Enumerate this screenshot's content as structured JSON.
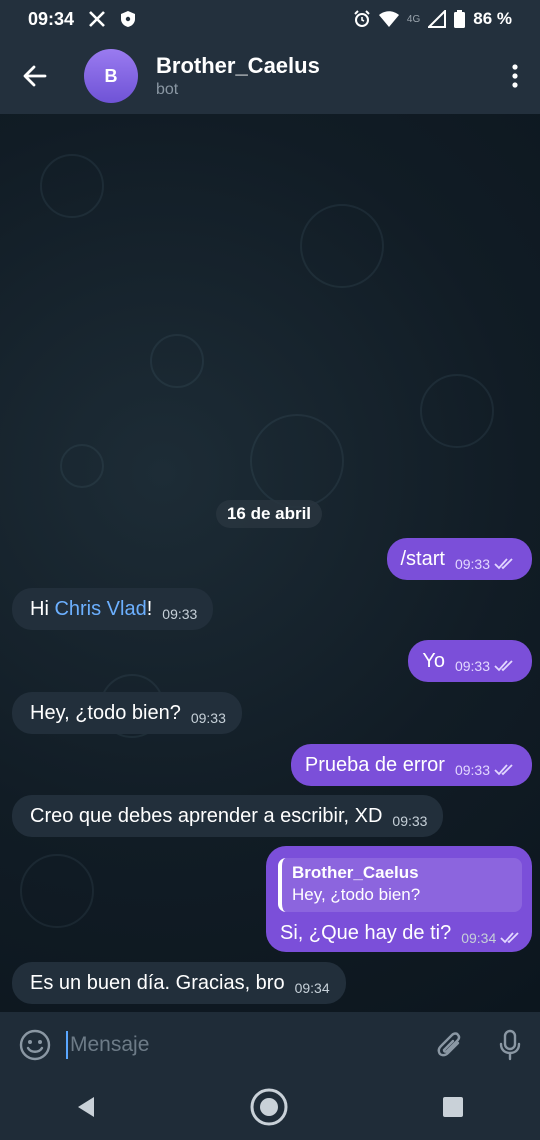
{
  "status": {
    "time": "09:34",
    "network": "4G",
    "battery": "86 %"
  },
  "header": {
    "avatar_letter": "B",
    "title": "Brother_Caelus",
    "subtitle": "bot"
  },
  "date_separator": "16 de abril",
  "messages": [
    {
      "text": "/start",
      "time": "09:33"
    },
    {
      "prefix": "Hi ",
      "mention": "Chris Vlad",
      "suffix": "!",
      "time": "09:33"
    },
    {
      "text": "Yo",
      "time": "09:33"
    },
    {
      "text": "Hey, ¿todo bien?",
      "time": "09:33"
    },
    {
      "text": "Prueba de error",
      "time": "09:33"
    },
    {
      "text": "Creo que debes aprender a escribir, XD",
      "time": "09:33"
    },
    {
      "reply_name": "Brother_Caelus",
      "reply_text": "Hey, ¿todo bien?",
      "text": "Si, ¿Que hay de ti?",
      "time": "09:34"
    },
    {
      "text": "Es un buen día. Gracias, bro",
      "time": "09:34"
    }
  ],
  "composer": {
    "placeholder": "Mensaje"
  },
  "icons": [
    "x-logo-icon",
    "shield-icon",
    "alarm-icon",
    "wifi-icon",
    "signal-icon",
    "battery-icon",
    "back-arrow-icon",
    "more-vert-icon",
    "emoji-icon",
    "attach-icon",
    "mic-icon",
    "nav-back-icon",
    "nav-home-icon",
    "nav-recents-icon"
  ]
}
